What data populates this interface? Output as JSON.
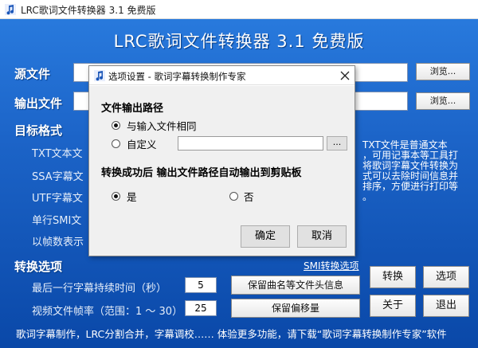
{
  "window": {
    "title": "LRC歌词文件转换器 3.1 免费版"
  },
  "banner": "LRC歌词文件转换器  3.1  免费版",
  "source": {
    "label": "源文件",
    "value": "",
    "browse": "浏览..."
  },
  "output": {
    "label": "输出文件",
    "value": "",
    "browse": "浏览..."
  },
  "target": {
    "label": "目标格式",
    "items": [
      "TXT文本文",
      "SSA字幕文",
      "UTF字幕文",
      "单行SMI文",
      "以帧数表示"
    ]
  },
  "description": "TXT文件是普通文本\n，可用记事本等工具打\n将歌词字幕文件转换为\n式可以去除时间信息并\n排序，方便进行打印等\n。",
  "options": {
    "label": "转换选项",
    "smi_link": "SMI转换选项",
    "duration_label": "最后一行字幕持续时间（秒）",
    "duration_value": "5",
    "keep_header": "保留曲名等文件头信息",
    "framerate_label": "视频文件帧率（范围：1 ～ 30）",
    "framerate_value": "25",
    "keep_offset": "保留偏移量"
  },
  "buttons": {
    "convert": "转换",
    "options": "选项",
    "about": "关于",
    "exit": "退出"
  },
  "footer": "歌词字幕制作，LRC分割合并，字幕调校……  体验更多功能，请下载“歌词字幕转换制作专家”软件",
  "dialog": {
    "title": "选项设置 - 歌词字幕转换制作专家",
    "section1": "文件输出路径",
    "same_as_input": "与输入文件相同",
    "custom": "自定义",
    "custom_value": "",
    "browse": "...",
    "section2": "转换成功后  输出文件路径自动输出到剪贴板",
    "yes": "是",
    "no": "否",
    "ok": "确定",
    "cancel": "取消"
  }
}
